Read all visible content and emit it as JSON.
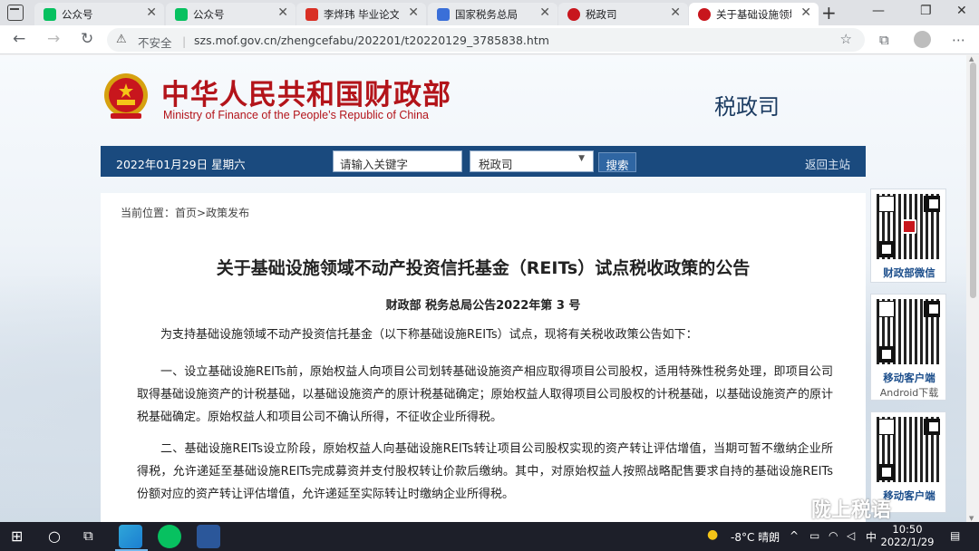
{
  "browser": {
    "tabs": [
      {
        "title": "公众号",
        "icon_color": "#07c160",
        "active": false
      },
      {
        "title": "公众号",
        "icon_color": "#07c160",
        "active": false
      },
      {
        "title": "李烨玮 毕业论文初稿",
        "icon_color": "#d93025",
        "active": false
      },
      {
        "title": "国家税务总局",
        "icon_color": "#3a6fd8",
        "active": false
      },
      {
        "title": "税政司",
        "icon_color": "#c8161d",
        "active": false
      },
      {
        "title": "关于基础设施领域不动产",
        "icon_color": "#c8161d",
        "active": true
      }
    ],
    "address": {
      "security_label": "不安全",
      "url": "szs.mof.gov.cn/zhengcefabu/202201/t20220129_3785838.htm"
    }
  },
  "site": {
    "name_cn": "中华人民共和国财政部",
    "name_en": "Ministry of Finance of the People’s Republic of China",
    "dept": "税政司",
    "brand_color": "#b3141a"
  },
  "navbar": {
    "date": "2022年01月29日  星期六",
    "search_text": "请输入关键字",
    "select_value": "税政司",
    "search_button": "搜索",
    "home_link": "返回主站"
  },
  "breadcrumb": {
    "prefix": "当前位置：",
    "home": "首页",
    "separator": ">",
    "section": "政策发布"
  },
  "article": {
    "title": "关于基础设施领域不动产投资信托基金（REITs）试点税收政策的公告",
    "doc_number": "财政部 税务总局公告2022年第 3 号",
    "paragraphs": [
      "为支持基础设施领域不动产投资信托基金（以下称基础设施REITs）试点，现将有关税收政策公告如下：",
      "一、设立基础设施REITs前，原始权益人向项目公司划转基础设施资产相应取得项目公司股权，适用特殊性税务处理，即项目公司取得基础设施资产的计税基础，以基础设施资产的原计税基础确定；原始权益人取得项目公司股权的计税基础，以基础设施资产的原计税基础确定。原始权益人和项目公司不确认所得，不征收企业所得税。",
      "二、基础设施REITs设立阶段，原始权益人向基础设施REITs转让项目公司股权实现的资产转让评估增值，当期可暂不缴纳企业所得税，允许递延至基础设施REITs完成募资并支付股权转让价款后缴纳。其中，对原始权益人按照战略配售要求自持的基础设施REITs份额对应的资产转让评估增值，允许递延至实际转让时缴纳企业所得税。"
    ]
  },
  "sidebar": [
    {
      "label": "财政部微信",
      "sub": ""
    },
    {
      "label": "移动客户端",
      "sub": "Android下载"
    },
    {
      "label": "移动客户端",
      "sub": ""
    }
  ],
  "watermark": "陇上税语",
  "taskbar": {
    "weather": "-8°C  晴朗",
    "ime": "中",
    "time": "10:50",
    "date": "2022/1/29"
  }
}
